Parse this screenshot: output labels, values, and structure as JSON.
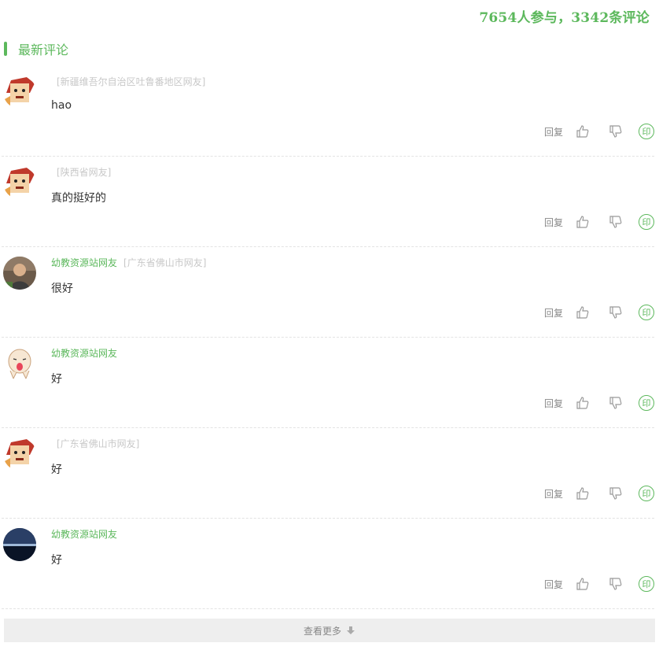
{
  "header": {
    "stats": "7654人参与，3342条评论"
  },
  "section": {
    "title": "最新评论"
  },
  "comments": [
    {
      "name": "",
      "location": "[新疆维吾尔自治区吐鲁番地区网友]",
      "content": "hao",
      "avatar": "cartoon-avatar"
    },
    {
      "name": "",
      "location": "[陕西省网友]",
      "content": "真的挺好的",
      "avatar": "cartoon-avatar"
    },
    {
      "name": "幼教资源站网友",
      "location": "[广东省佛山市网友]",
      "content": "很好",
      "avatar": "photo-avatar"
    },
    {
      "name": "幼教资源站网友",
      "location": "",
      "content": "好",
      "avatar": "egg-avatar"
    },
    {
      "name": "",
      "location": "[广东省佛山市网友]",
      "content": "好",
      "avatar": "cartoon-avatar"
    },
    {
      "name": "幼教资源站网友",
      "location": "",
      "content": "好",
      "avatar": "landscape-avatar"
    }
  ],
  "actions": {
    "reply": "回复",
    "seal": "印"
  },
  "footer": {
    "more": "查看更多"
  },
  "colors": {
    "accent": "#5cb85c",
    "muted": "#c8c8c8"
  }
}
